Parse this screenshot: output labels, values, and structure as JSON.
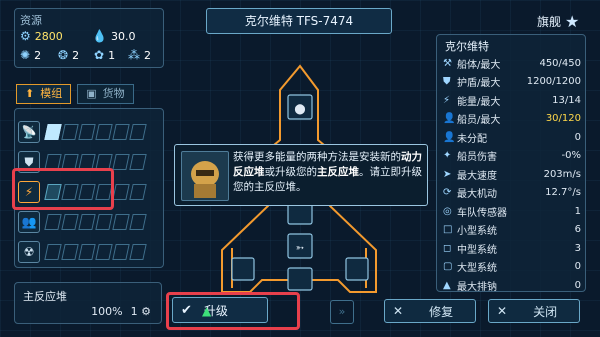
{
  "resources": {
    "title": "资源",
    "credits": "2800",
    "water": "30.0",
    "counts": [
      "2",
      "2",
      "1",
      "2"
    ]
  },
  "ship": {
    "name": "克尔维特 TFS-7474",
    "flagship_label": "旗舰"
  },
  "tabs": [
    {
      "label": "模组",
      "active": true
    },
    {
      "label": "货物",
      "active": false
    }
  ],
  "modules": [
    {
      "icon": "satellite-icon",
      "slots": [
        "on",
        "off",
        "off",
        "off",
        "off",
        "off"
      ]
    },
    {
      "icon": "shield-icon",
      "slots": [
        "off",
        "off",
        "off",
        "off",
        "off",
        "off"
      ]
    },
    {
      "icon": "lightning-icon",
      "slots": [
        "part",
        "off",
        "off",
        "off",
        "off",
        "off"
      ]
    },
    {
      "icon": "crew-icon",
      "slots": [
        "off",
        "off",
        "off",
        "off",
        "off",
        "off"
      ]
    },
    {
      "icon": "radiation-icon",
      "slots": [
        "off",
        "off",
        "off",
        "off",
        "off",
        "off"
      ]
    }
  ],
  "tooltip": {
    "line1": "获得更多能量的两种方法是安装新的",
    "hl1": "动力反应堆",
    "mid": "或升级您的",
    "hl2": "主反应堆",
    "line3": "。请立即升级您的主反应堆。"
  },
  "reactor": {
    "title": "主反应堆",
    "percent": "100%",
    "level": "1"
  },
  "buttons": {
    "upgrade": "升级",
    "repair": "修复",
    "close": "关闭"
  },
  "stats": {
    "title": "克尔维特",
    "rows": [
      {
        "icon": "hull-icon",
        "label": "船体/最大",
        "value": "450/450"
      },
      {
        "icon": "shield-icon",
        "label": "护盾/最大",
        "value": "1200/1200"
      },
      {
        "icon": "energy-icon",
        "label": "能量/最大",
        "value": "13/14"
      },
      {
        "icon": "crew-icon",
        "label": "船员/最大",
        "value": "30/120"
      },
      {
        "icon": "unassigned-icon",
        "label": "未分配",
        "value": "0"
      },
      {
        "icon": "crew-damage-icon",
        "label": "船员伤害",
        "value": "-0%"
      },
      {
        "icon": "speed-icon",
        "label": "最大速度",
        "value": "203m/s"
      },
      {
        "icon": "maneuver-icon",
        "label": "最大机动",
        "value": "12.7°/s"
      },
      {
        "icon": "sensor-icon",
        "label": "车队传感器",
        "value": "1"
      },
      {
        "icon": "small-system-icon",
        "label": "小型系统",
        "value": "6"
      },
      {
        "icon": "medium-system-icon",
        "label": "中型系统",
        "value": "3"
      },
      {
        "icon": "large-system-icon",
        "label": "大型系统",
        "value": "0"
      },
      {
        "icon": "displacement-icon",
        "label": "最大排钠",
        "value": "0"
      }
    ]
  },
  "colors": {
    "accent": "#ffa83a",
    "highlight_red": "#e8404c",
    "stat_value_yellow": "#ffd84a",
    "ship_outline": "#f39a2e"
  }
}
